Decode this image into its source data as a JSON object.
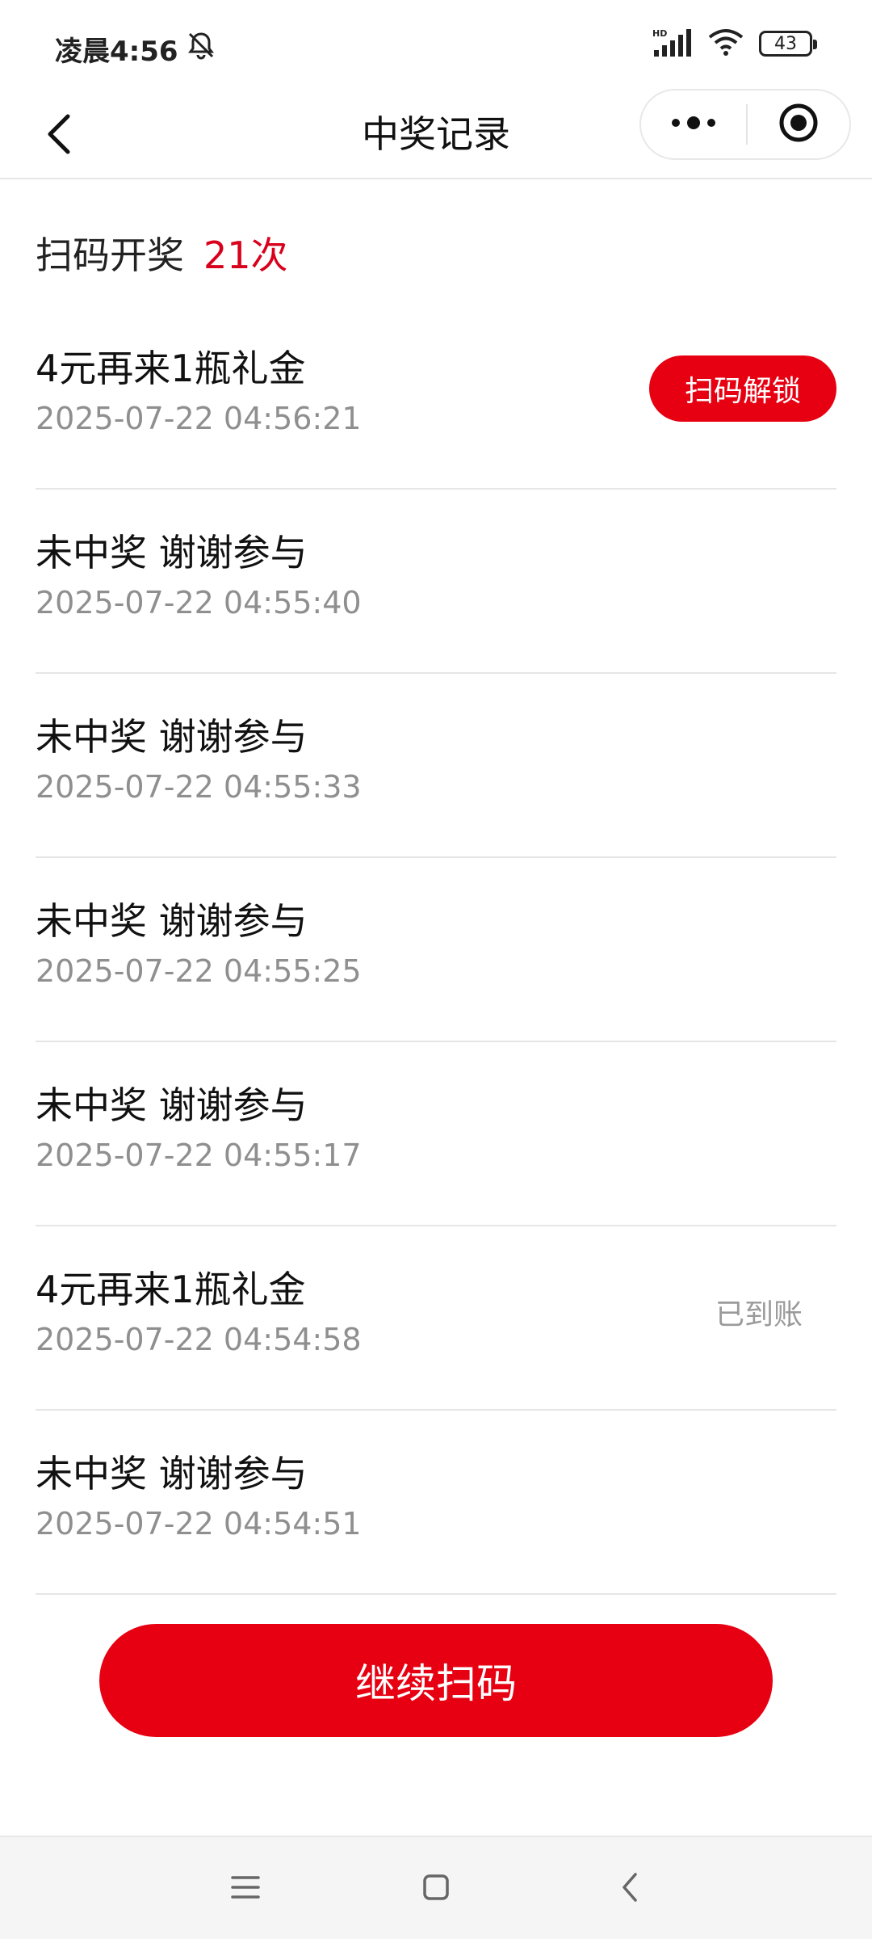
{
  "status_bar": {
    "time": "凌晨4:56",
    "network": "HD",
    "battery": "43",
    "icons": [
      "bell-muted-icon",
      "signal-icon",
      "wifi-icon",
      "battery-icon"
    ]
  },
  "nav": {
    "title": "中奖记录",
    "icons": [
      "back-arrow-icon",
      "more-dots-icon",
      "close-circle-icon"
    ]
  },
  "summary": {
    "label": "扫码开奖",
    "count": "21次"
  },
  "records": [
    {
      "title": "4元再来1瓶礼金",
      "time": "2025-07-22 04:56:21",
      "action": "扫码解锁"
    },
    {
      "title": "未中奖 谢谢参与",
      "time": "2025-07-22 04:55:40"
    },
    {
      "title": "未中奖 谢谢参与",
      "time": "2025-07-22 04:55:33"
    },
    {
      "title": "未中奖 谢谢参与",
      "time": "2025-07-22 04:55:25"
    },
    {
      "title": "未中奖 谢谢参与",
      "time": "2025-07-22 04:55:17"
    },
    {
      "title": "4元再来1瓶礼金",
      "time": "2025-07-22 04:54:58",
      "status": "已到账"
    },
    {
      "title": "未中奖 谢谢参与",
      "time": "2025-07-22 04:54:51"
    }
  ],
  "continue_button": "继续扫码",
  "system_nav": [
    "menu-icon",
    "home-icon",
    "back-icon"
  ],
  "colors": {
    "accent": "#e60012",
    "count": "#d9001b",
    "secondary_text": "#8f8f8f"
  }
}
